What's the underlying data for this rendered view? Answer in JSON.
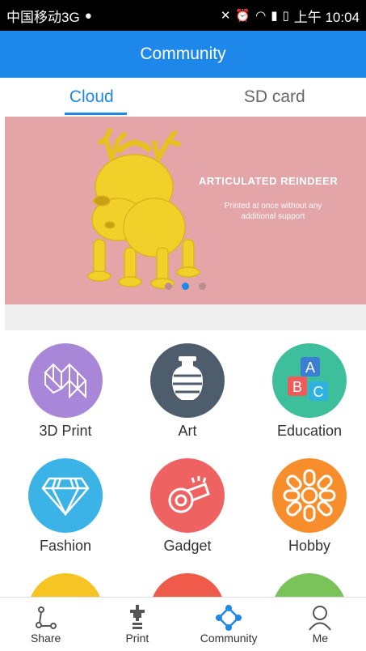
{
  "status_bar": {
    "carrier": "中国移动3G",
    "time": "上午 10:04"
  },
  "app_bar": {
    "title": "Community"
  },
  "tabs": [
    {
      "label": "Cloud",
      "active": true
    },
    {
      "label": "SD card",
      "active": false
    }
  ],
  "banner": {
    "title": "ARTICULATED REINDEER",
    "subtitle": "Printed at once without any additional support",
    "dots": 3,
    "active_dot": 2
  },
  "categories": [
    {
      "label": "3D Print",
      "color": "#a987d8",
      "icon": "lattice-icon"
    },
    {
      "label": "Art",
      "color": "#4e5d6c",
      "icon": "vase-icon"
    },
    {
      "label": "Education",
      "color": "#3cbf9a",
      "icon": "abc-blocks-icon"
    },
    {
      "label": "Fashion",
      "color": "#3bb3e6",
      "icon": "diamond-icon"
    },
    {
      "label": "Gadget",
      "color": "#ef6262",
      "icon": "whistle-icon"
    },
    {
      "label": "Hobby",
      "color": "#f78d2b",
      "icon": "chain-ring-icon"
    }
  ],
  "partial_row_colors": [
    "#f6c523",
    "#ef5b4a",
    "#7ac35a"
  ],
  "bottom_nav": [
    {
      "label": "Share",
      "icon": "share-icon"
    },
    {
      "label": "Print",
      "icon": "printer-nozzle-icon"
    },
    {
      "label": "Community",
      "icon": "community-icon",
      "active": true,
      "color": "#1e88ea"
    },
    {
      "label": "Me",
      "icon": "person-icon"
    }
  ]
}
